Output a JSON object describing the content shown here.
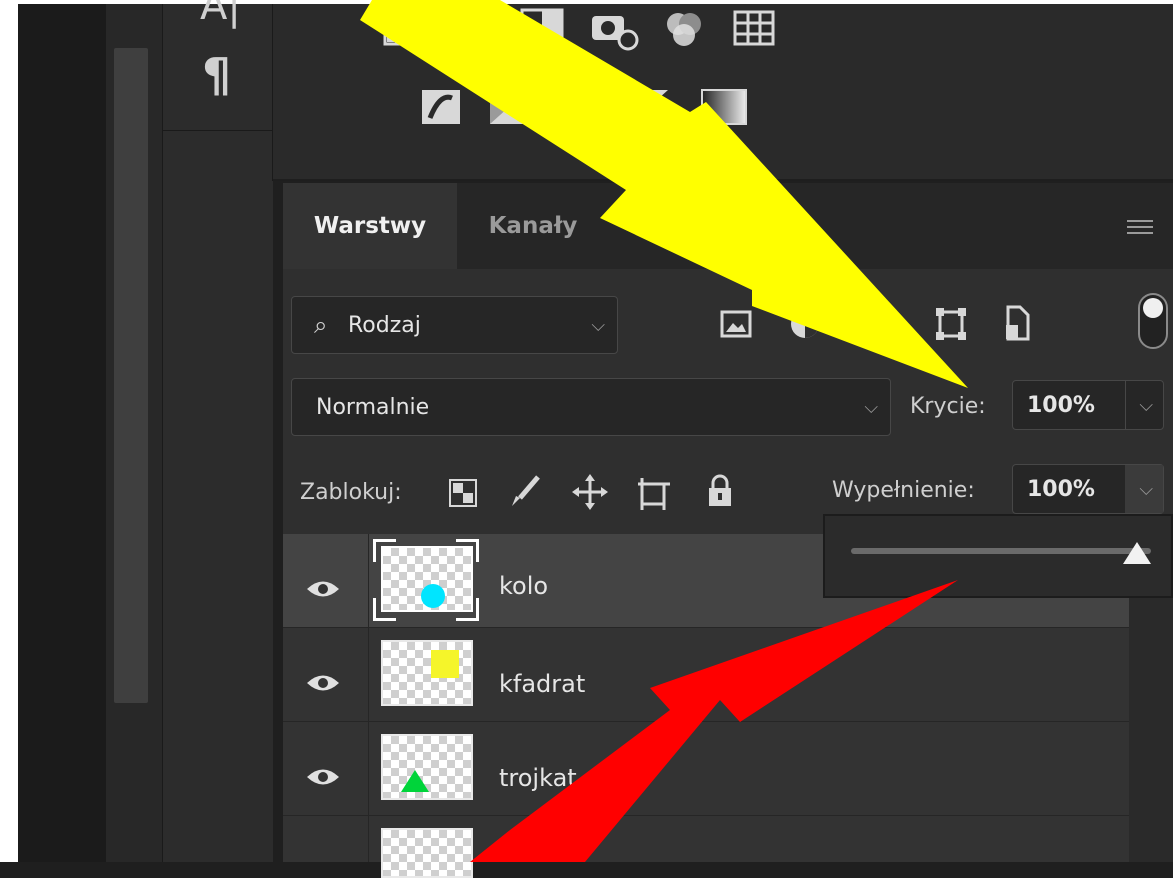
{
  "tool_glyphs": {
    "paragraph": "¶",
    "text_partial": "A|"
  },
  "tabs": [
    {
      "label": "Warstwy"
    },
    {
      "label": "Kanały"
    }
  ],
  "filter": {
    "search_glyph": "⌕",
    "kind_label": "Rodzaj"
  },
  "blend_mode": {
    "value": "Normalnie"
  },
  "opacity": {
    "label": "Krycie:",
    "value": "100%"
  },
  "lock": {
    "label": "Zablokuj:"
  },
  "fill": {
    "label": "Wypełnienie:",
    "value": "100%",
    "slider_level": 1.0
  },
  "layers": [
    {
      "name": "kolo",
      "selected": true,
      "shape": "circle",
      "color": "#00e5ff"
    },
    {
      "name": "kfadrat",
      "selected": false,
      "shape": "square",
      "color": "#f5f52a"
    },
    {
      "name": "trojkat",
      "selected": false,
      "shape": "triangle",
      "color": "#00d43a"
    },
    {
      "name": "",
      "selected": false,
      "shape": "none",
      "color": ""
    }
  ],
  "annotations": {
    "yellow_arrow_color": "#ffff00",
    "red_arrow_color": "#ff0000"
  }
}
